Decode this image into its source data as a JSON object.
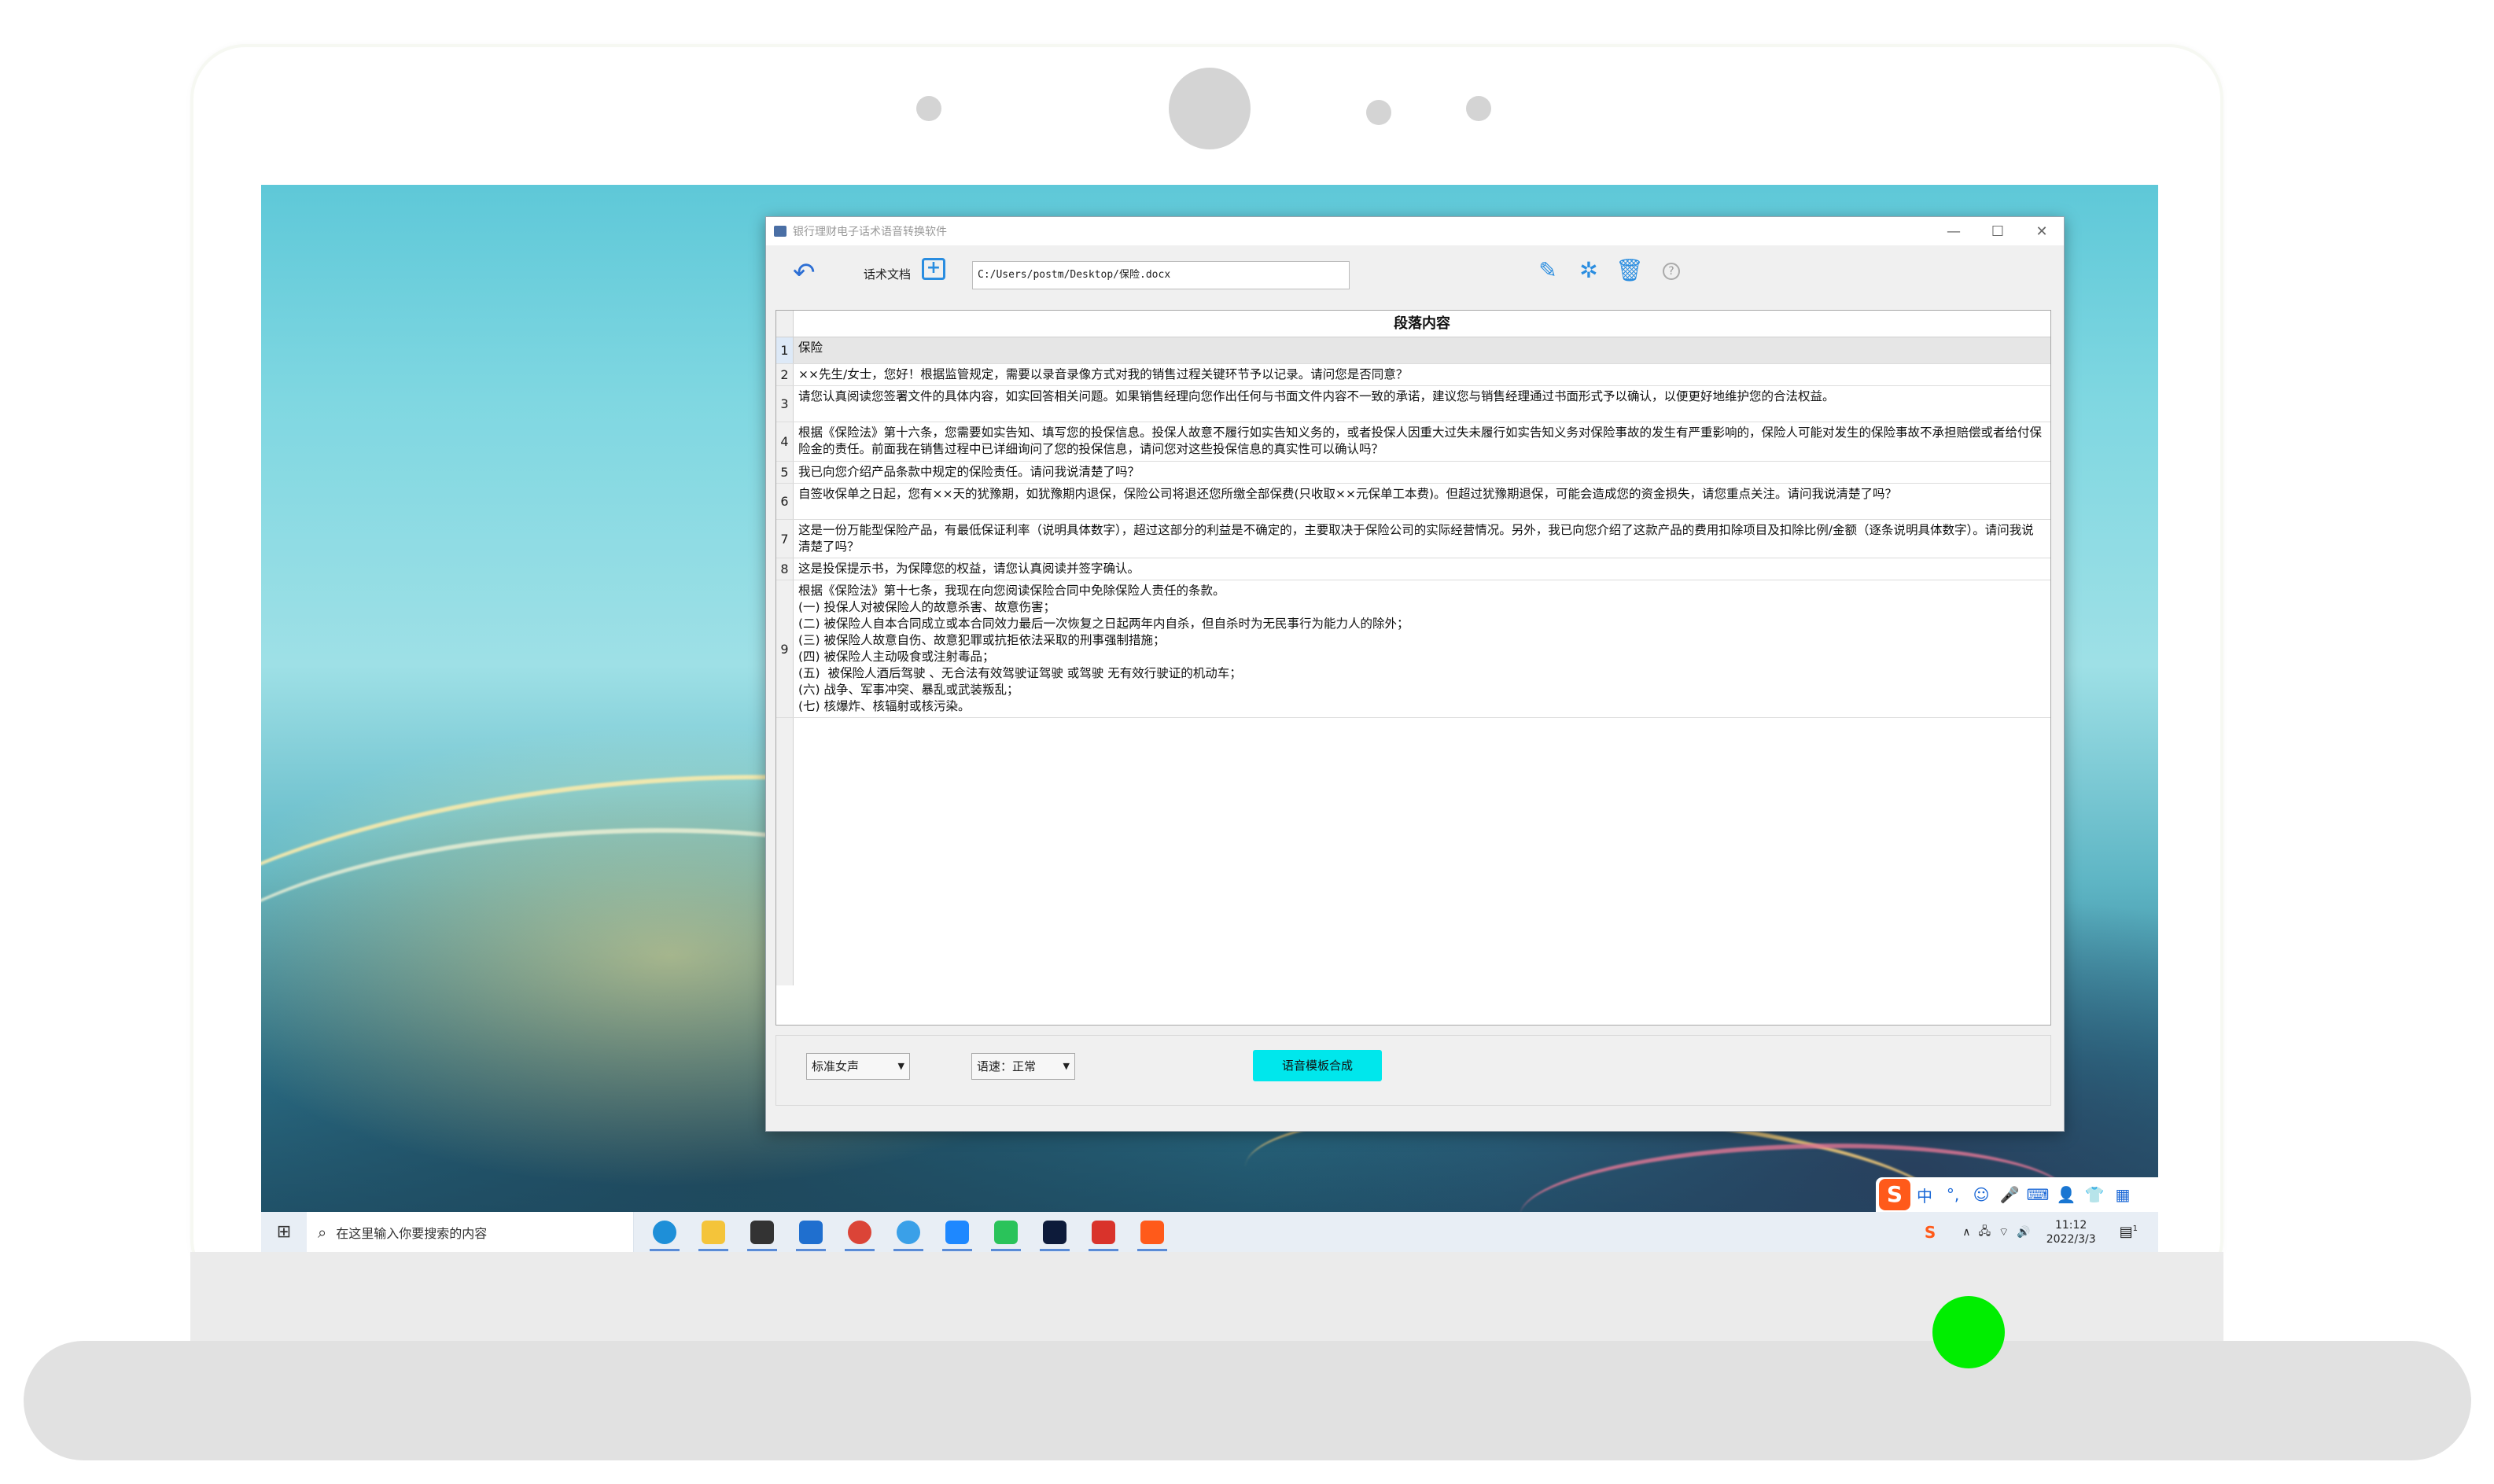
{
  "window": {
    "title": "银行理财电子话术语音转换软件",
    "controls": {
      "minimize": "—",
      "maximize": "☐",
      "close": "✕"
    }
  },
  "toolbar": {
    "back_icon": "back-arrow-icon",
    "doc_label": "话术文档",
    "file_path": "C:/Users/postm/Desktop/保险.docx",
    "icons": [
      "edit-icon",
      "split-icon",
      "trash-icon",
      "help-icon"
    ],
    "help_glyph": "?"
  },
  "table": {
    "column_header": "段落内容",
    "rows": [
      {
        "num": "1",
        "text": "保险",
        "selected": true
      },
      {
        "num": "2",
        "text": "××先生/女士，您好！根据监管规定，需要以录音录像方式对我的销售过程关键环节予以记录。请问您是否同意？"
      },
      {
        "num": "3",
        "text": "请您认真阅读您签署文件的具体内容，如实回答相关问题。如果销售经理向您作出任何与书面文件内容不一致的承诺，建议您与销售经理通过书面形式予以确认，以便更好地维护您的合法权益。"
      },
      {
        "num": "4",
        "text": "根据《保险法》第十六条，您需要如实告知、填写您的投保信息。投保人故意不履行如实告知义务的，或者投保人因重大过失未履行如实告知义务对保险事故的发生有严重影响的，保险人可能对发生的保险事故不承担赔偿或者给付保险金的责任。前面我在销售过程中已详细询问了您的投保信息，请问您对这些投保信息的真实性可以确认吗？"
      },
      {
        "num": "5",
        "text": "我已向您介绍产品条款中规定的保险责任。请问我说清楚了吗？"
      },
      {
        "num": "6",
        "text": "自签收保单之日起，您有××天的犹豫期，如犹豫期内退保，保险公司将退还您所缴全部保费(只收取××元保单工本费)。但超过犹豫期退保，可能会造成您的资金损失，请您重点关注。请问我说清楚了吗？"
      },
      {
        "num": "7",
        "text": "这是一份万能型保险产品，有最低保证利率（说明具体数字），超过这部分的利益是不确定的，主要取决于保险公司的实际经营情况。另外，我已向您介绍了这款产品的费用扣除项目及扣除比例/金额（逐条说明具体数字）。请问我说清楚了吗？"
      },
      {
        "num": "8",
        "text": "这是投保提示书，为保障您的权益，请您认真阅读并签字确认。"
      },
      {
        "num": "9",
        "text": "根据《保险法》第十七条，我现在向您阅读保险合同中免除保险人责任的条款。\n(一) 投保人对被保险人的故意杀害、故意伤害；\n(二) 被保险人自本合同成立或本合同效力最后一次恢复之日起两年内自杀，但自杀时为无民事行为能力人的除外；\n(三) 被保险人故意自伤、故意犯罪或抗拒依法采取的刑事强制措施；\n(四) 被保险人主动吸食或注射毒品；\n(五)  被保险人酒后驾驶 、无合法有效驾驶证驾驶 或驾驶 无有效行驶证的机动车；\n(六) 战争、军事冲突、暴乱或武装叛乱；\n(七) 核爆炸、核辐射或核污染。"
      }
    ]
  },
  "bottom": {
    "voice_select": "标准女声",
    "speed_select": "语速：正常",
    "synth_button": "语音模板合成"
  },
  "taskbar": {
    "search_placeholder": "在这里输入你要搜索的内容",
    "apps": [
      "edge-icon",
      "file-explorer-icon",
      "store-icon",
      "mail-icon",
      "chrome-icon",
      "ie-icon",
      "feishu-icon",
      "wechat-icon",
      "photoshop-icon",
      "wps-icon",
      "sogou-app-icon"
    ],
    "time": "11:12",
    "date": "2022/3/3",
    "notification_count": "1"
  },
  "ime": {
    "logo": "S",
    "items": [
      "中",
      "°,",
      "☺",
      "🎤",
      "⌨",
      "👤",
      "👕",
      "▦"
    ]
  },
  "colors": {
    "accent": "#2a8de0",
    "synth_button": "#00e7ec",
    "led": "#00ee00"
  }
}
